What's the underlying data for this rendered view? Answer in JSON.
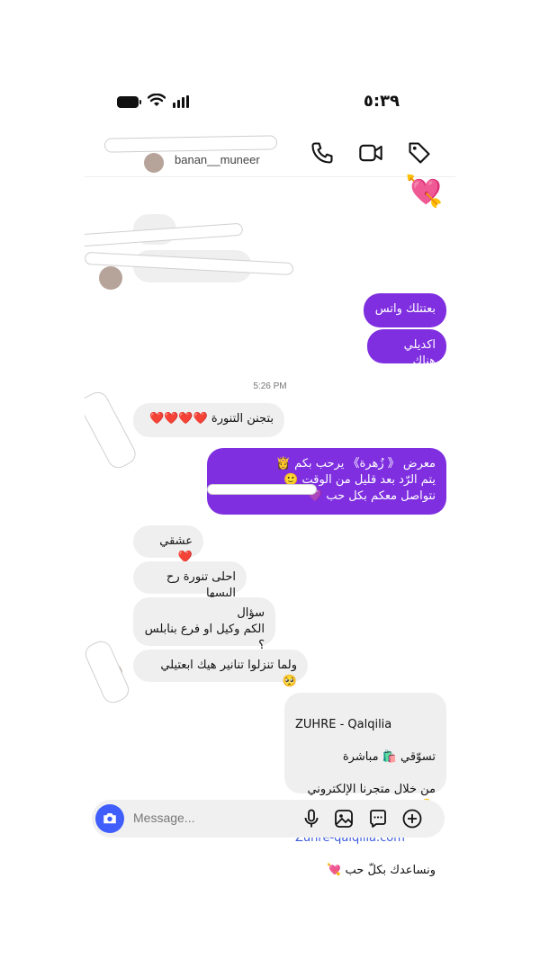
{
  "status_bar": {
    "time": "٥:٣٩"
  },
  "header": {
    "username": "banan__muneer"
  },
  "messages": {
    "out_1": "بعتتلك واتس",
    "out_2": "اكديلي هناك",
    "timestamp": "5:26 PM",
    "in_1": "بتجنن التنورة ❤️❤️❤️❤️",
    "auto_reply": "معرض 《 زُهرة》 يرحب بكم 👸\nيتم الرّد بعد قليل من الوقت 🙂\nنتواصل معكم بكل حب 💜",
    "in_2": "عشقي ❤️",
    "in_3": "احلى تنورة رح البسها",
    "in_4": "سؤال\nالكم وكيل او فرع بنابلس ؟",
    "in_5": "ولما تنزلوا تنانير هيك ابعتيلي 🥺",
    "promo": {
      "line1": "ZUHRE - Qalqilia",
      "line2": "تسوّقي 🛍️ مباشرة",
      "line3": "من خلال متجرنا الإلكتروني 👇",
      "link": "Zuhre-qalqilia.com",
      "line5": "ونساعدك بكلّ حب 💘"
    },
    "sticker": "💘"
  },
  "composer": {
    "placeholder": "Message..."
  },
  "icons": [
    "battery-icon",
    "wifi-icon",
    "signal-icon",
    "phone-icon",
    "video-icon",
    "tag-icon",
    "camera-icon",
    "mic-icon",
    "gallery-icon",
    "sticker-icon",
    "plus-icon"
  ]
}
